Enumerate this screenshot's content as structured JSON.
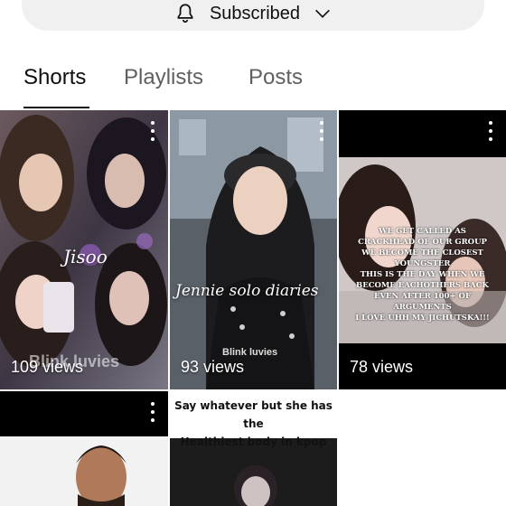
{
  "subscribe": {
    "label": "Subscribed",
    "icon": "bell-icon",
    "chevron": "chevron-down-icon"
  },
  "tabs": [
    {
      "label": "Shorts",
      "active": true
    },
    {
      "label": "Playlists",
      "active": false
    },
    {
      "label": "Posts",
      "active": false
    }
  ],
  "shorts": [
    {
      "views": "109 views",
      "overlay_title": "Jisoo",
      "overlay_watermark": "Blink luvies"
    },
    {
      "views": "93 views",
      "overlay_title": "Jennie solo diaries",
      "overlay_watermark": "Blink luvies"
    },
    {
      "views": "78 views",
      "overlay_lines": [
        "WE GET CALLED AS",
        "CRACKHEAD OF OUR GROUP",
        "WE BECOME THE CLOSEST YOUNGSTER",
        "THIS IS THE DAY WHEN WE",
        "BECOME EACHOTHERS BACK",
        "EVEN AFTER 100+ OF ARGUMENTS",
        "I LOVE UHH MY JICHUTSKA!!!"
      ]
    },
    {
      "views": ""
    },
    {
      "views": "",
      "caption_lines": [
        "Say whatever but she has the",
        "Healthiest body in kpop"
      ]
    }
  ],
  "colors": {
    "bg": "#ffffff",
    "text": "#0f0f0f",
    "muted": "#606060",
    "button": "#f0f0f0"
  }
}
